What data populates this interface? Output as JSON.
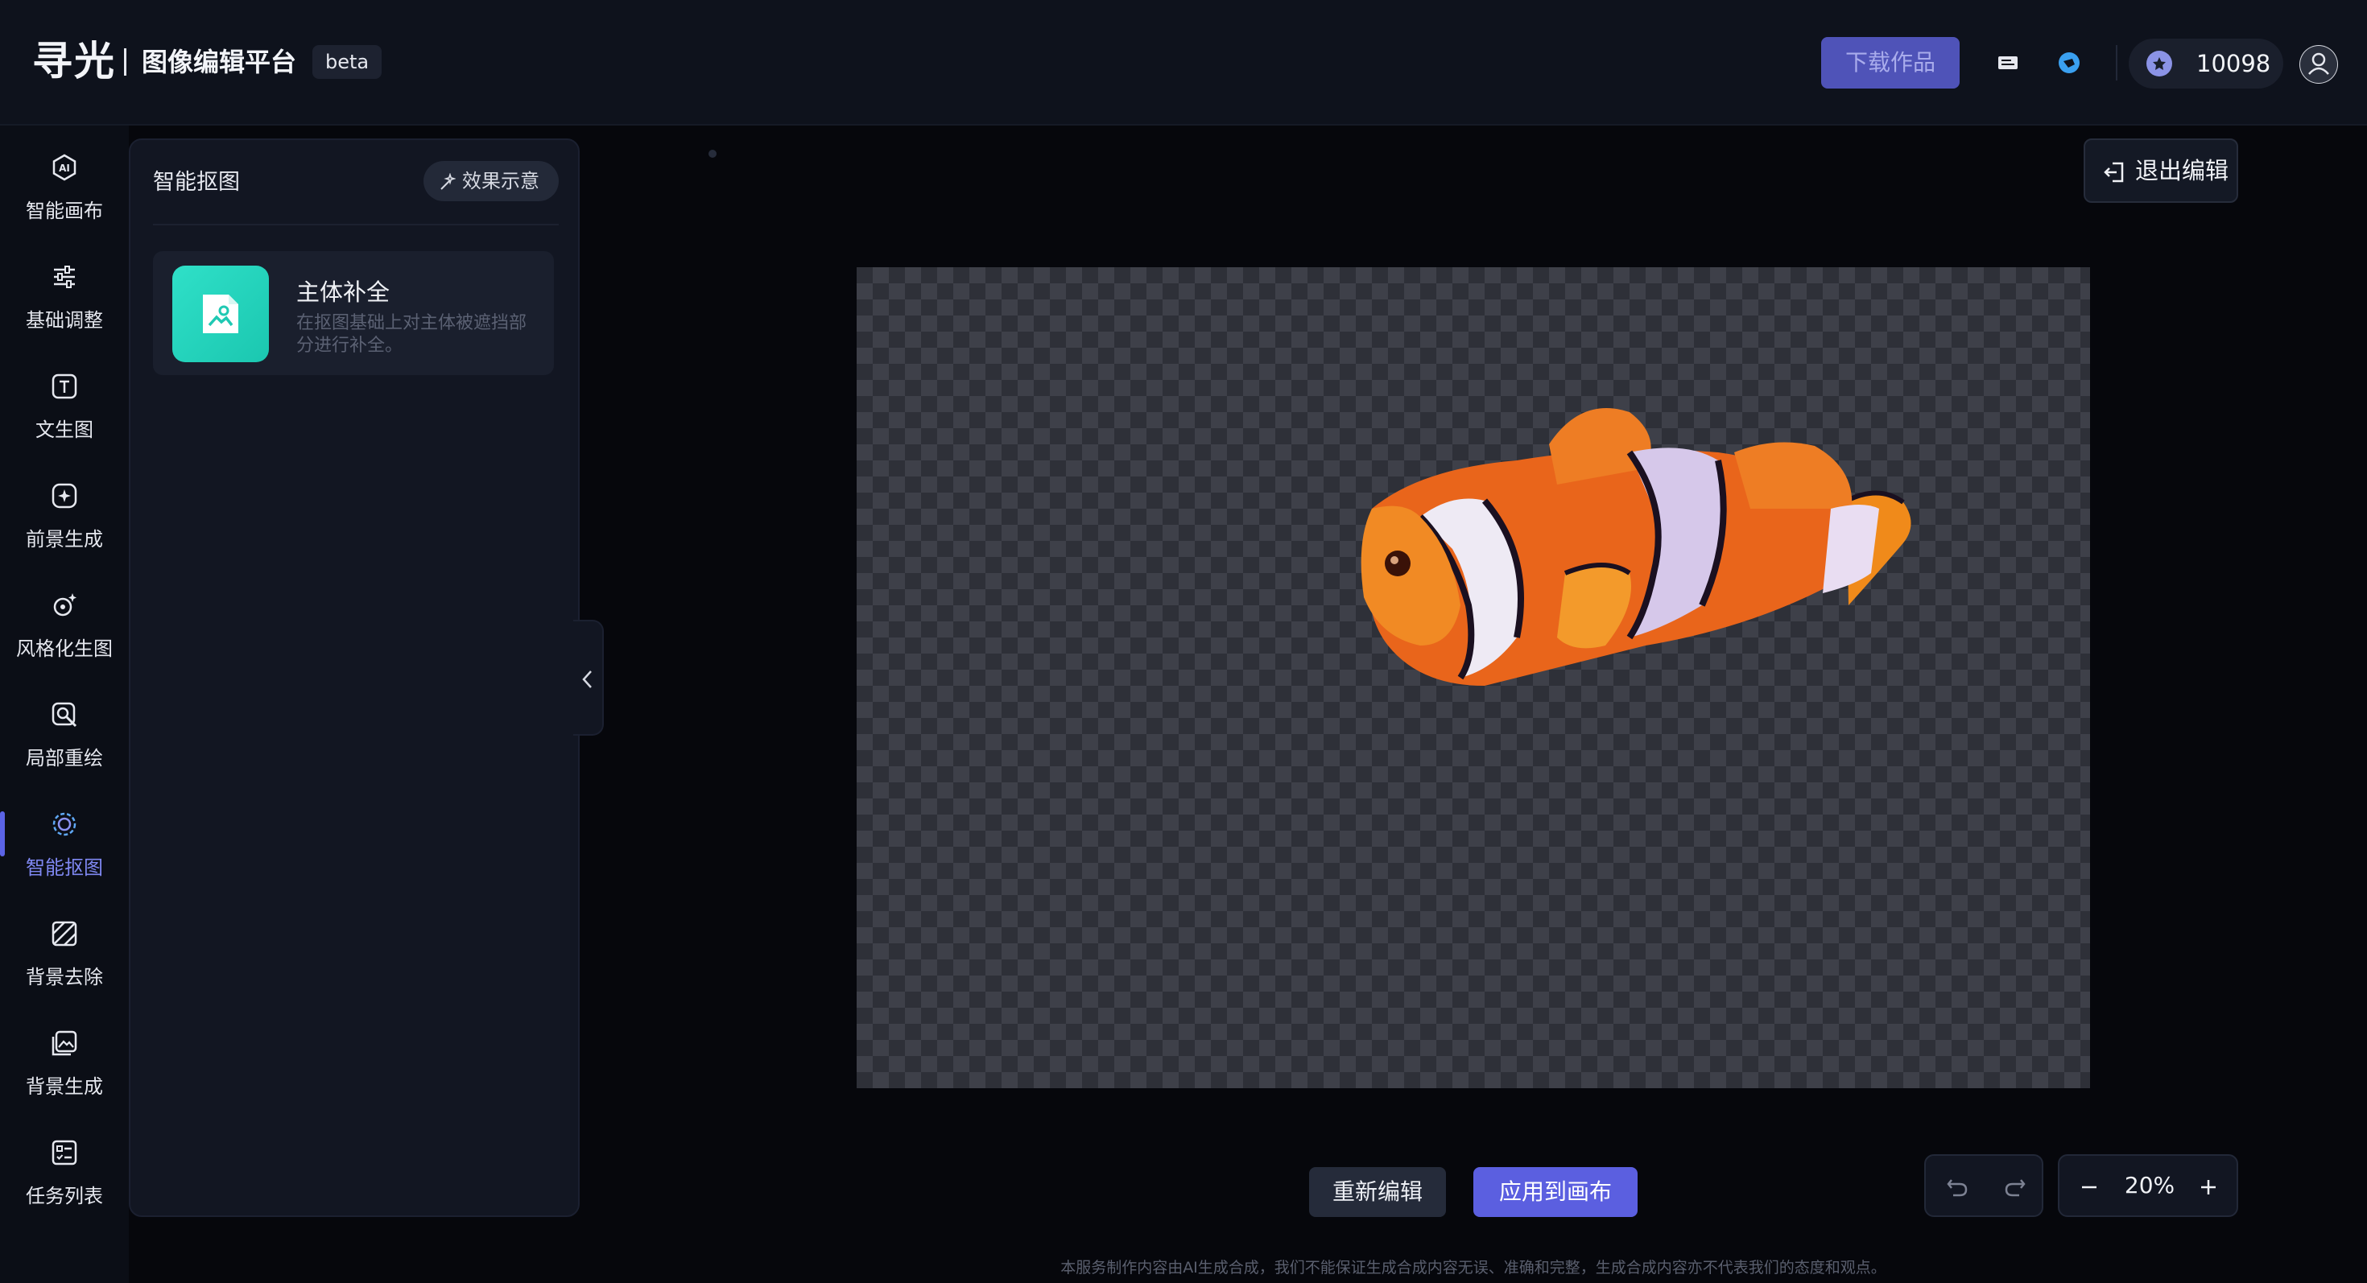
{
  "header": {
    "logo": "寻光",
    "app_title": "图像编辑平台",
    "beta": "beta",
    "download_label": "下载作品",
    "credits": "10098",
    "icons": [
      "monitor-icon",
      "bird-icon",
      "credit-coin-icon",
      "user-icon"
    ]
  },
  "nav": {
    "items": [
      {
        "label": "智能画布",
        "icon": "ai-hexagon-icon"
      },
      {
        "label": "基础调整",
        "icon": "sliders-icon"
      },
      {
        "label": "文生图",
        "icon": "text-box-icon"
      },
      {
        "label": "前景生成",
        "icon": "sparkle-box-icon"
      },
      {
        "label": "风格化生图",
        "icon": "style-sparkle-icon"
      },
      {
        "label": "局部重绘",
        "icon": "local-repaint-icon"
      },
      {
        "label": "智能抠图",
        "icon": "smart-cutout-icon"
      },
      {
        "label": "背景去除",
        "icon": "background-remove-icon"
      },
      {
        "label": "背景生成",
        "icon": "background-generate-icon"
      },
      {
        "label": "任务列表",
        "icon": "task-list-icon"
      }
    ],
    "active_index": 6
  },
  "panel": {
    "title": "智能抠图",
    "demo_label": "效果示意",
    "feature": {
      "title": "主体补全",
      "desc": "在抠图基础上对主体被遮挡部分进行补全。"
    }
  },
  "canvas": {
    "exit_label": "退出编辑",
    "reedit_label": "重新编辑",
    "apply_label": "应用到画布",
    "zoom": "20%",
    "disclaimer": "本服务制作内容由AI生成合成，我们不能保证生成合成内容无误、准确和完整，生成合成内容亦不代表我们的态度和观点。"
  },
  "colors": {
    "accent": "#5b5fe0",
    "active_nav": "#7f88f2",
    "feature_icon": "#22d3bd"
  }
}
